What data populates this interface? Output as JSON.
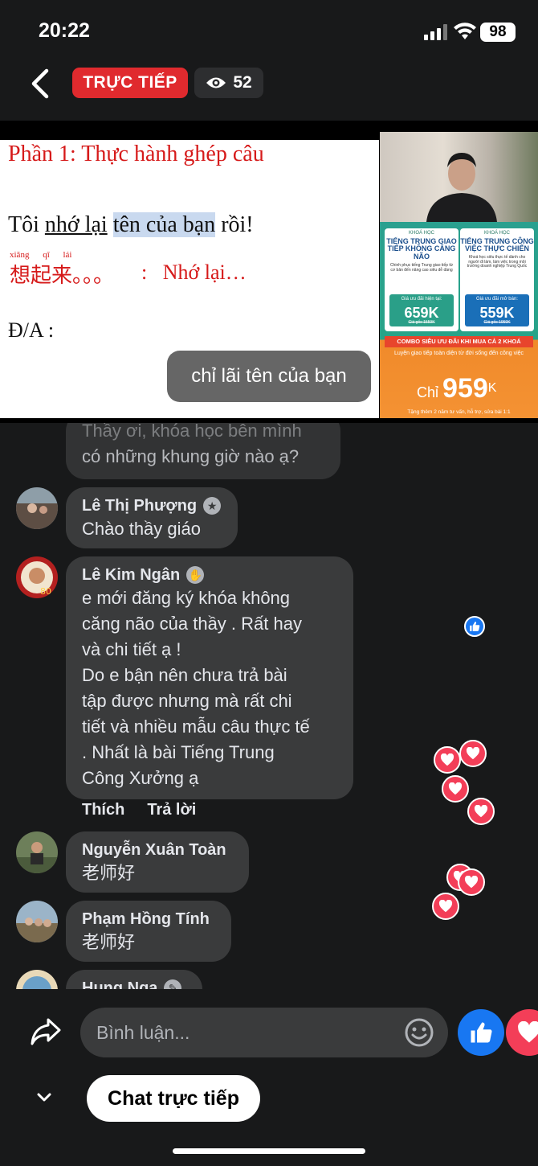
{
  "status_bar": {
    "time": "20:22",
    "battery": "98"
  },
  "header": {
    "live_label": "TRỰC TIẾP",
    "viewer_count": "52"
  },
  "video": {
    "slide": {
      "title": "Phần 1: Thực hành ghép câu",
      "sentence_prefix": "Tôi ",
      "sentence_underlined": "nhớ lại",
      "sentence_space": " ",
      "sentence_highlight": "tên của bạn",
      "sentence_suffix": " rồi!",
      "pinyin": "xiǎng qǐ lái",
      "hanzi": "想起来。。。",
      "colon": ":",
      "meaning": "Nhớ lại…",
      "answer_label": "Đ/A :"
    },
    "caption_bubble": "chỉ lãi tên của bạn",
    "ad": {
      "card_a": {
        "kicker": "KHOÁ HỌC",
        "name": "TIẾNG TRUNG GIAO TIẾP KHÔNG CĂNG NÃO",
        "desc": "Chinh phục tiếng Trung giao tiếp từ cơ bản đến nâng cao siêu dễ dàng",
        "price_label": "Giá ưu đãi hiện tại:",
        "price": "659K",
        "old_price": "Giá gốc 1559K"
      },
      "card_b": {
        "kicker": "KHOÁ HỌC",
        "name": "TIẾNG TRUNG CÔNG VIỆC THỰC CHIẾN",
        "desc": "Khoá học siêu thực tế dành cho người đi làm, làm việc trong môi trường doanh nghiệp Trung Quốc",
        "price_label": "Giá ưu đãi mở bán:",
        "price": "559K",
        "old_price": "Giá gốc 1959K"
      },
      "combo": "COMBO SIÊU ƯU ĐÃI KHI MUA CẢ 2 KHOÁ",
      "combo_sub": "Luyện giao tiếp toàn diện từ đời sống đến công việc",
      "chi": "Chỉ",
      "combo_price": "959",
      "combo_unit": "K",
      "footer": "Tặng thêm 2 năm tư vấn, hỗ trợ, sửa bài 1:1"
    }
  },
  "comments": [
    {
      "name": "",
      "lines": [
        "Thầy ơi, khóa học bên mình",
        "có những khung giờ nào ạ?"
      ]
    },
    {
      "name": "Lê Thị Phượng",
      "lines": [
        "Chào thầy giáo"
      ]
    },
    {
      "name": "Lê Kim Ngân",
      "lines": [
        "e mới đăng ký khóa không",
        "căng não của thầy . Rất hay",
        "và chi tiết ạ !",
        "Do e bận nên chưa trả bài",
        "tập được nhưng mà rất chi",
        "tiết và nhiều mẫu câu thực tế",
        ". Nhất là bài Tiếng Trung",
        "Công Xưởng ạ"
      ]
    },
    {
      "name": "Nguyễn Xuân Toàn",
      "lines": [
        "老师好"
      ]
    },
    {
      "name": "Phạm Hồng Tính",
      "lines": [
        "老师好"
      ]
    },
    {
      "name": "Hung Nga",
      "lines": []
    }
  ],
  "comment_actions": {
    "like": "Thích",
    "reply": "Trả lời"
  },
  "composer": {
    "placeholder": "Bình luận..."
  },
  "bottom": {
    "chat_live": "Chat trực tiếp"
  },
  "colors": {
    "live_red": "#e02a2e",
    "like_blue": "#1877f2",
    "love_red": "#f33e58",
    "bubble_gray": "#3a3b3c"
  }
}
